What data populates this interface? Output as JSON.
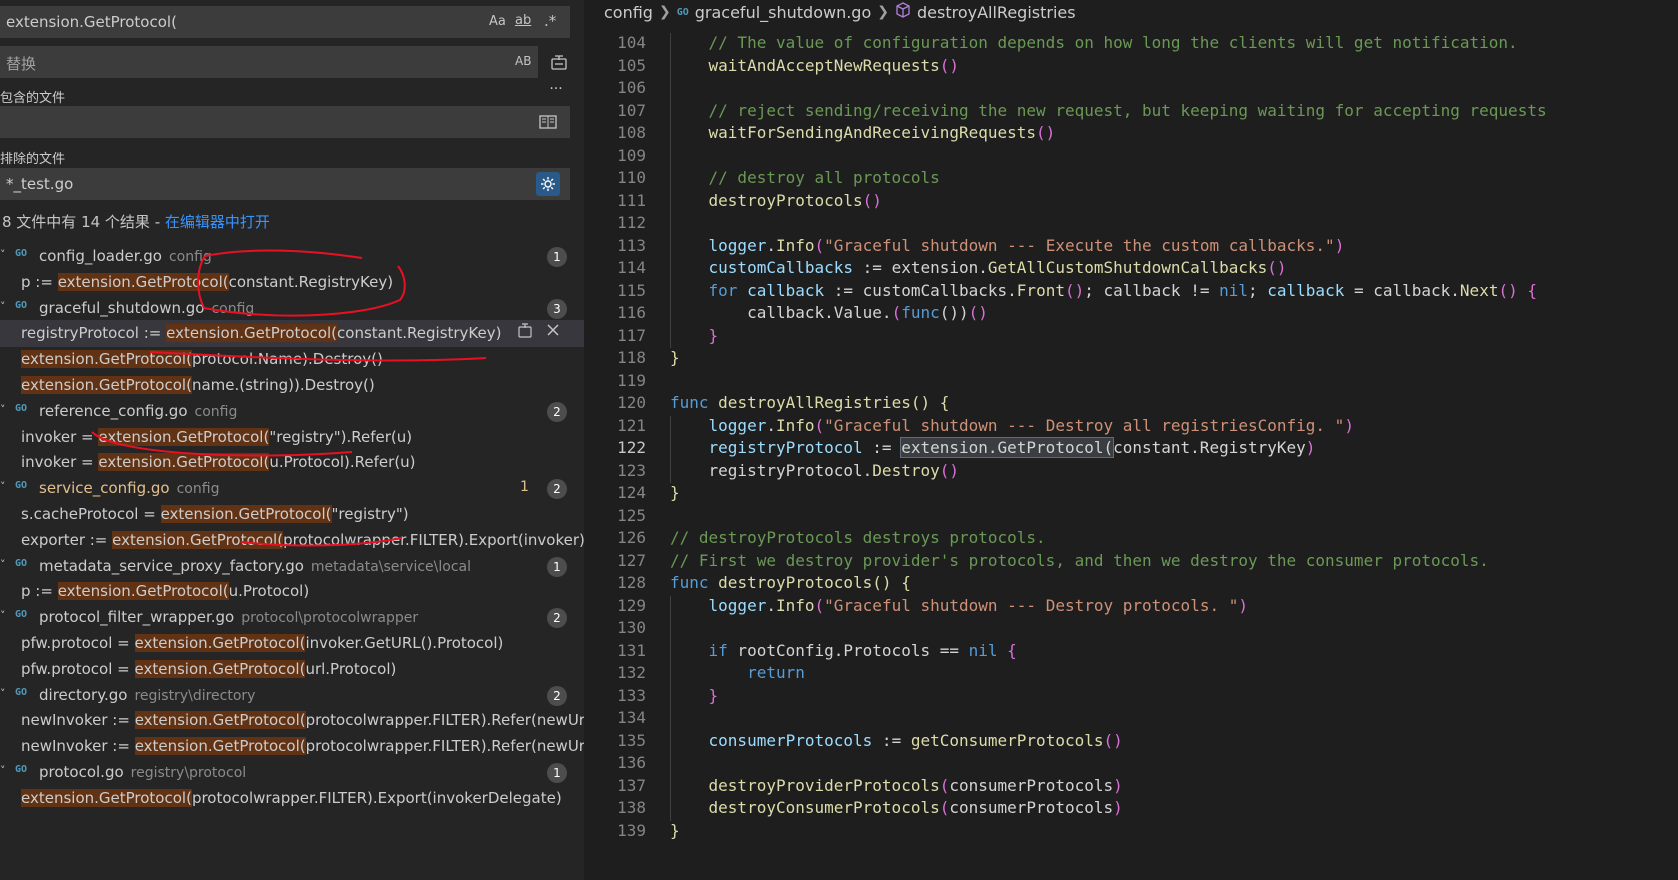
{
  "search": {
    "query": "extension.GetProtocol(",
    "match_case": "Aa",
    "whole_word": "ab",
    "regex": ".*",
    "replace_placeholder": "替换",
    "preserve_case": "AB",
    "toggle_details": "···",
    "include_label": "包含的文件",
    "include_value": "",
    "exclude_label": "排除的文件",
    "exclude_value": "*_test.go",
    "summary": "8 文件中有 14 个结果 - ",
    "open_in_editor": "在编辑器中打开"
  },
  "results": [
    {
      "file": "config_loader.go",
      "path": "config",
      "count": "1",
      "modified": false,
      "matches": [
        {
          "before": "p := ",
          "match": "extension.GetProtocol(",
          "after": "constant.RegistryKey)"
        }
      ]
    },
    {
      "file": "graceful_shutdown.go",
      "path": "config",
      "count": "3",
      "modified": false,
      "matches": [
        {
          "before": "registryProtocol := ",
          "match": "extension.GetProtocol(",
          "after": "constant.RegistryKey)",
          "selected": true
        },
        {
          "before": "",
          "match": "extension.GetProtocol(",
          "after": "protocol.Name).Destroy()"
        },
        {
          "before": "",
          "match": "extension.GetProtocol(",
          "after": "name.(string)).Destroy()"
        }
      ]
    },
    {
      "file": "reference_config.go",
      "path": "config",
      "count": "2",
      "modified": false,
      "matches": [
        {
          "before": "invoker = ",
          "match": "extension.GetProtocol(",
          "after": "\"registry\").Refer(u)"
        },
        {
          "before": "invoker = ",
          "match": "extension.GetProtocol(",
          "after": "u.Protocol).Refer(u)"
        }
      ]
    },
    {
      "file": "service_config.go",
      "path": "config",
      "count": "2",
      "modified": true,
      "mcount": "1",
      "matches": [
        {
          "before": "s.cacheProtocol = ",
          "match": "extension.GetProtocol(",
          "after": "\"registry\")"
        },
        {
          "before": "exporter := ",
          "match": "extension.GetProtocol(",
          "after": "protocolwrapper.FILTER).Export(invoker)"
        }
      ]
    },
    {
      "file": "metadata_service_proxy_factory.go",
      "path": "metadata\\service\\local",
      "count": "1",
      "modified": false,
      "matches": [
        {
          "before": "p := ",
          "match": "extension.GetProtocol(",
          "after": "u.Protocol)"
        }
      ]
    },
    {
      "file": "protocol_filter_wrapper.go",
      "path": "protocol\\protocolwrapper",
      "count": "2",
      "modified": false,
      "matches": [
        {
          "before": "pfw.protocol = ",
          "match": "extension.GetProtocol(",
          "after": "invoker.GetURL().Protocol)"
        },
        {
          "before": "pfw.protocol = ",
          "match": "extension.GetProtocol(",
          "after": "url.Protocol)"
        }
      ]
    },
    {
      "file": "directory.go",
      "path": "registry\\directory",
      "count": "2",
      "modified": false,
      "matches": [
        {
          "before": "newInvoker := ",
          "match": "extension.GetProtocol(",
          "after": "protocolwrapper.FILTER).Refer(newUrl)"
        },
        {
          "before": "newInvoker := ",
          "match": "extension.GetProtocol(",
          "after": "protocolwrapper.FILTER).Refer(newUrl)"
        }
      ]
    },
    {
      "file": "protocol.go",
      "path": "registry\\protocol",
      "count": "1",
      "modified": false,
      "matches": [
        {
          "before": "",
          "match": "extension.GetProtocol(",
          "after": "protocolwrapper.FILTER).Export(invokerDelegate)"
        }
      ]
    }
  ],
  "breadcrumb": {
    "folder": "config",
    "file": "graceful_shutdown.go",
    "symbol": "destroyAllRegistries"
  },
  "icons": {
    "go_file": "GO",
    "chevron": "chevron-down-icon",
    "symbol": "cube-icon"
  },
  "colors": {
    "highlight": "#613214",
    "annotation": "#e81123",
    "link": "#3794ff"
  },
  "editor": {
    "current_line": "122",
    "lines": [
      {
        "n": "104",
        "t": [
          [
            "    ",
            ""
          ],
          [
            "// The value of configuration depends on how long the clients will get notification.",
            "c-com"
          ]
        ]
      },
      {
        "n": "105",
        "t": [
          [
            "    ",
            ""
          ],
          [
            "waitAndAcceptNewRequests",
            "c-fn"
          ],
          [
            "()",
            "c-br"
          ]
        ]
      },
      {
        "n": "106",
        "t": []
      },
      {
        "n": "107",
        "t": [
          [
            "    ",
            ""
          ],
          [
            "// reject sending/receiving the new request, but keeping waiting for accepting requests",
            "c-com"
          ]
        ]
      },
      {
        "n": "108",
        "t": [
          [
            "    ",
            ""
          ],
          [
            "waitForSendingAndReceivingRequests",
            "c-fn"
          ],
          [
            "()",
            "c-br"
          ]
        ]
      },
      {
        "n": "109",
        "t": []
      },
      {
        "n": "110",
        "t": [
          [
            "    ",
            ""
          ],
          [
            "// destroy all protocols",
            "c-com"
          ]
        ]
      },
      {
        "n": "111",
        "t": [
          [
            "    ",
            ""
          ],
          [
            "destroyProtocols",
            "c-fn"
          ],
          [
            "()",
            "c-br"
          ]
        ]
      },
      {
        "n": "112",
        "t": []
      },
      {
        "n": "113",
        "t": [
          [
            "    ",
            ""
          ],
          [
            "logger",
            "c-var"
          ],
          [
            ".",
            "c-pun"
          ],
          [
            "Info",
            "c-fn"
          ],
          [
            "(",
            "c-br"
          ],
          [
            "\"Graceful shutdown --- Execute the custom callbacks.\"",
            "c-str"
          ],
          [
            ")",
            "c-br"
          ]
        ]
      },
      {
        "n": "114",
        "t": [
          [
            "    ",
            ""
          ],
          [
            "customCallbacks",
            "c-var"
          ],
          [
            " := extension.",
            "c-pun"
          ],
          [
            "GetAllCustomShutdownCallbacks",
            "c-fn"
          ],
          [
            "()",
            "c-br"
          ]
        ]
      },
      {
        "n": "115",
        "t": [
          [
            "    ",
            ""
          ],
          [
            "for",
            "c-kw"
          ],
          [
            " ",
            ""
          ],
          [
            "callback",
            "c-var"
          ],
          [
            " := customCallbacks.",
            "c-pun"
          ],
          [
            "Front",
            "c-fn"
          ],
          [
            "()",
            "c-br"
          ],
          [
            "; callback != ",
            "c-pun"
          ],
          [
            "nil",
            "c-kw"
          ],
          [
            "; ",
            "c-pun"
          ],
          [
            "callback",
            "c-var"
          ],
          [
            " = callback.",
            "c-pun"
          ],
          [
            "Next",
            "c-fn"
          ],
          [
            "()",
            "c-br"
          ],
          [
            " ",
            ""
          ],
          [
            "{",
            "c-br"
          ]
        ]
      },
      {
        "n": "116",
        "t": [
          [
            "        ",
            ""
          ],
          [
            "callback.Value.",
            "c-pun"
          ],
          [
            "(",
            "c-br"
          ],
          [
            "func",
            "c-kw"
          ],
          [
            "())",
            "c-pun"
          ],
          [
            "()",
            "c-br"
          ]
        ]
      },
      {
        "n": "117",
        "t": [
          [
            "    ",
            ""
          ],
          [
            "}",
            "c-br"
          ]
        ]
      },
      {
        "n": "118",
        "t": [
          [
            "}",
            "c-fn"
          ]
        ]
      },
      {
        "n": "119",
        "t": []
      },
      {
        "n": "120",
        "t": [
          [
            "func",
            "c-kw"
          ],
          [
            " ",
            ""
          ],
          [
            "destroyAllRegistries",
            "c-fn"
          ],
          [
            "() {",
            "c-fn"
          ]
        ]
      },
      {
        "n": "121",
        "t": [
          [
            "    ",
            ""
          ],
          [
            "logger",
            "c-var"
          ],
          [
            ".",
            "c-pun"
          ],
          [
            "Info",
            "c-fn"
          ],
          [
            "(",
            "c-br"
          ],
          [
            "\"Graceful shutdown --- Destroy all registriesConfig. \"",
            "c-str"
          ],
          [
            ")",
            "c-br"
          ]
        ]
      },
      {
        "n": "122",
        "t": [
          [
            "    ",
            ""
          ],
          [
            "registryProtocol",
            "c-var"
          ],
          [
            " := ",
            "c-pun"
          ],
          [
            "extension.GetProtocol(",
            "sel-bg"
          ],
          [
            "constant.RegistryKey",
            "c-pun"
          ],
          [
            ")",
            "c-br"
          ]
        ]
      },
      {
        "n": "123",
        "t": [
          [
            "    ",
            ""
          ],
          [
            "registryProtocol.",
            "c-pun"
          ],
          [
            "Destroy",
            "c-fn"
          ],
          [
            "()",
            "c-br"
          ]
        ]
      },
      {
        "n": "124",
        "t": [
          [
            "}",
            "c-fn"
          ]
        ]
      },
      {
        "n": "125",
        "t": []
      },
      {
        "n": "126",
        "t": [
          [
            "// destroyProtocols destroys protocols.",
            "c-com"
          ]
        ]
      },
      {
        "n": "127",
        "t": [
          [
            "// First we destroy provider's protocols, and then we destroy the consumer protocols.",
            "c-com"
          ]
        ]
      },
      {
        "n": "128",
        "t": [
          [
            "func",
            "c-kw"
          ],
          [
            " ",
            ""
          ],
          [
            "destroyProtocols",
            "c-fn"
          ],
          [
            "() {",
            "c-fn"
          ]
        ]
      },
      {
        "n": "129",
        "t": [
          [
            "    ",
            ""
          ],
          [
            "logger",
            "c-var"
          ],
          [
            ".",
            "c-pun"
          ],
          [
            "Info",
            "c-fn"
          ],
          [
            "(",
            "c-br"
          ],
          [
            "\"Graceful shutdown --- Destroy protocols. \"",
            "c-str"
          ],
          [
            ")",
            "c-br"
          ]
        ]
      },
      {
        "n": "130",
        "t": []
      },
      {
        "n": "131",
        "t": [
          [
            "    ",
            ""
          ],
          [
            "if",
            "c-kw"
          ],
          [
            " rootConfig.Protocols == ",
            "c-pun"
          ],
          [
            "nil",
            "c-kw"
          ],
          [
            " ",
            ""
          ],
          [
            "{",
            "c-br"
          ]
        ]
      },
      {
        "n": "132",
        "t": [
          [
            "        ",
            ""
          ],
          [
            "return",
            "c-kw"
          ]
        ]
      },
      {
        "n": "133",
        "t": [
          [
            "    ",
            ""
          ],
          [
            "}",
            "c-br"
          ]
        ]
      },
      {
        "n": "134",
        "t": []
      },
      {
        "n": "135",
        "t": [
          [
            "    ",
            ""
          ],
          [
            "consumerProtocols",
            "c-var"
          ],
          [
            " := ",
            "c-pun"
          ],
          [
            "getConsumerProtocols",
            "c-fn"
          ],
          [
            "()",
            "c-br"
          ]
        ]
      },
      {
        "n": "136",
        "t": []
      },
      {
        "n": "137",
        "t": [
          [
            "    ",
            ""
          ],
          [
            "destroyProviderProtocols",
            "c-fn"
          ],
          [
            "(",
            "c-br"
          ],
          [
            "consumerProtocols",
            "c-pun"
          ],
          [
            ")",
            "c-br"
          ]
        ]
      },
      {
        "n": "138",
        "t": [
          [
            "    ",
            ""
          ],
          [
            "destroyConsumerProtocols",
            "c-fn"
          ],
          [
            "(",
            "c-br"
          ],
          [
            "consumerProtocols",
            "c-pun"
          ],
          [
            ")",
            "c-br"
          ]
        ]
      },
      {
        "n": "139",
        "t": [
          [
            "}",
            "c-fn"
          ]
        ]
      }
    ]
  }
}
